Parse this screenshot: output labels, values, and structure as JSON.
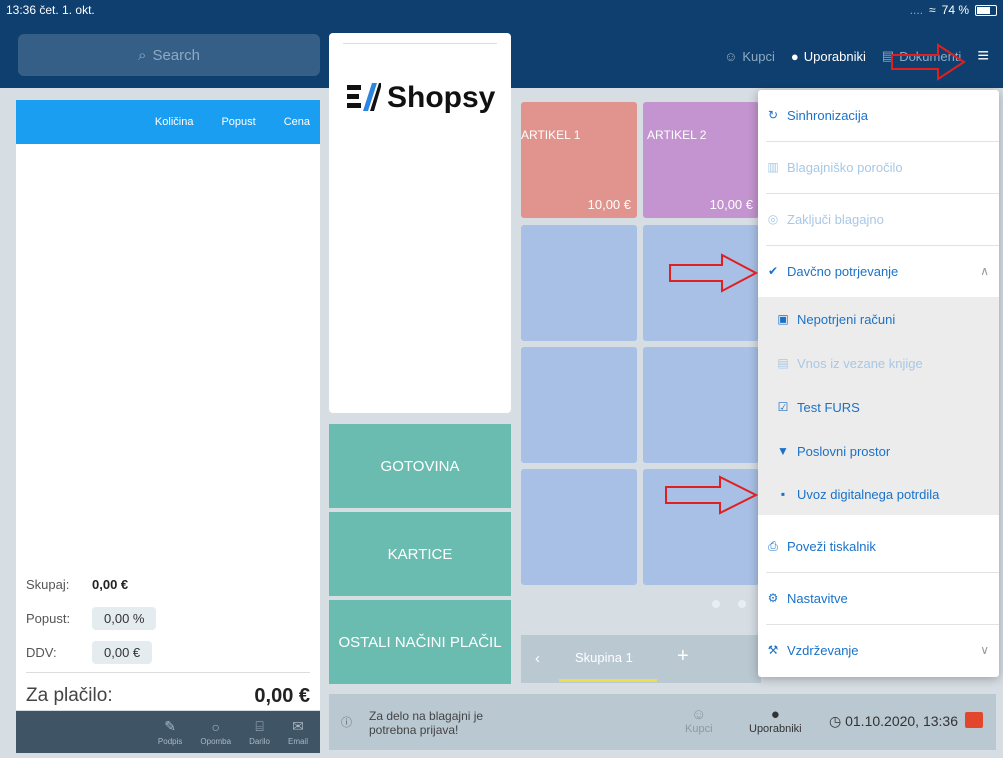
{
  "status_bar": {
    "time": "13:36",
    "date": "čet. 1. okt.",
    "signal": "....",
    "battery": "74 %"
  },
  "header": {
    "search_placeholder": "Search",
    "nav": {
      "kupci": "Kupci",
      "uporabniki": "Uporabniki",
      "dokumenti": "Dokumenti"
    }
  },
  "cart": {
    "columns": {
      "qty": "Količina",
      "discount": "Popust",
      "price": "Cena"
    },
    "totals": {
      "skupaj_label": "Skupaj:",
      "skupaj_value": "0,00 €",
      "popust_label": "Popust:",
      "popust_value": "0,00 %",
      "ddv_label": "DDV:",
      "ddv_value": "0,00 €",
      "za_placilo_label": "Za plačilo:",
      "za_placilo_value": "0,00 €"
    },
    "footer": {
      "podpis": "Podpis",
      "opomba": "Opomba",
      "darilo": "Darilo",
      "email": "Email"
    }
  },
  "logo": {
    "brand": "Shopsy"
  },
  "payment": {
    "gotovina": "GOTOVINA",
    "kartice": "KARTICE",
    "ostali": "OSTALI NAČINI PLAČIL"
  },
  "items": [
    {
      "name": "ARTIKEL 1",
      "price": "10,00 €",
      "color": "#e0948d"
    },
    {
      "name": "ARTIKEL 2",
      "price": "10,00 €",
      "color": "#c394cf"
    }
  ],
  "groups": {
    "active": "Skupina 1"
  },
  "infobar": {
    "message": "Za delo na blagajni je potrebna prijava!",
    "kupci": "Kupci",
    "uporabniki": "Uporabniki",
    "datetime": "01.10.2020, 13:36"
  },
  "menu": {
    "sinhronizacija": "Sinhronizacija",
    "blagajnisko": "Blagajniško poročilo",
    "zakljuci": "Zaključi blagajno",
    "davcno": "Davčno potrjevanje",
    "nepotrjeni": "Nepotrjeni računi",
    "vnos": "Vnos iz vezane knjige",
    "test": "Test FURS",
    "poslovni": "Poslovni prostor",
    "uvoz": "Uvoz digitalnega potrdila",
    "povezi": "Poveži tiskalnik",
    "nastavitve": "Nastavitve",
    "vzdrzevanje": "Vzdrževanje"
  },
  "colors": {
    "navy": "#0f3f6e",
    "accent_blue": "#1a9ef2",
    "teal": "#6bbcb0",
    "tile_blue": "#a8c0e6",
    "link": "#1a72c8",
    "arrow_red": "#e02020"
  }
}
